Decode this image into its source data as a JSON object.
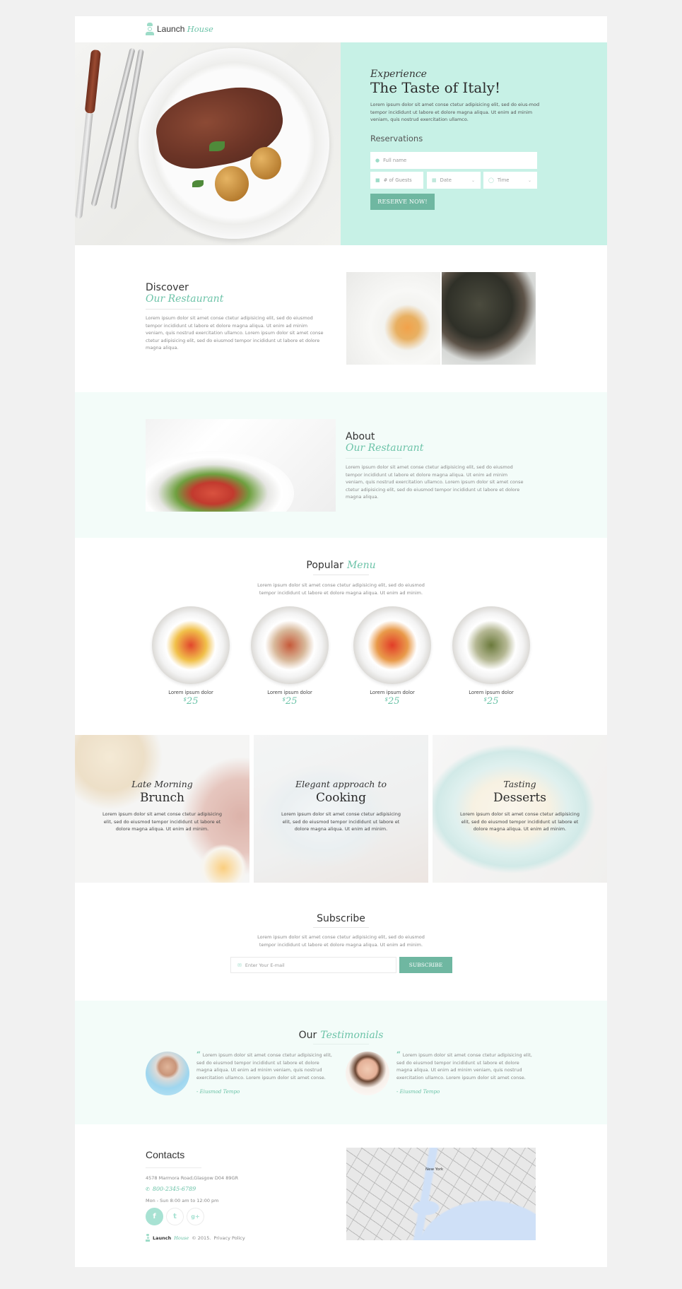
{
  "brand": {
    "name_plain": "Launch",
    "name_accent": "House"
  },
  "hero": {
    "kicker": "Experience",
    "title": "The Taste of Italy!",
    "text": "Lorem ipsum dolor sit amet conse ctetur adipisicing elit, sed do eius-mod tempor incididunt ut labore et dolore magna aliqua. Ut enim ad minim veniam, quis nostrud exercitation ullamco.",
    "reservations_title": "Reservations",
    "form": {
      "full_name_placeholder": "Full name",
      "guests_placeholder": "# of Guests",
      "date_placeholder": "Date",
      "time_placeholder": "Time",
      "submit_label": "RESERVE NOW!"
    }
  },
  "discover": {
    "title_plain": "Discover",
    "title_accent": "Our Restaurant",
    "text": "Lorem ipsum dolor sit amet conse ctetur adipisicing elit, sed do eiusmod tempor incididunt ut labore et dolore magna aliqua. Ut enim ad minim veniam, quis nostrud exercitation ullamco. Lorem ipsum dolor sit amet conse ctetur adipisicing elit, sed do eiusmod tempor incididunt ut labore et dolore magna aliqua."
  },
  "about": {
    "title_plain": "About",
    "title_accent": "Our Restaurant",
    "text": "Lorem ipsum dolor sit amet conse ctetur adipisicing elit, sed do eiusmod tempor incididunt ut labore et dolore magna aliqua. Ut enim ad minim veniam, quis nostrud exercitation ullamco. Lorem ipsum dolor sit amet conse ctetur adipisicing elit, sed do eiusmod tempor incididunt ut labore et dolore magna aliqua."
  },
  "menu": {
    "title_plain": "Popular",
    "title_accent": "Menu",
    "text": "Lorem ipsum dolor sit amet conse ctetur adipisicing elit, sed do eiusmod tempor incididunt ut labore et dolore magna aliqua. Ut enim ad minim.",
    "items": [
      {
        "name": "Lorem ipsum dolor",
        "currency": "$",
        "price": "25"
      },
      {
        "name": "Lorem ipsum dolor",
        "currency": "$",
        "price": "25"
      },
      {
        "name": "Lorem ipsum dolor",
        "currency": "$",
        "price": "25"
      },
      {
        "name": "Lorem ipsum dolor",
        "currency": "$",
        "price": "25"
      }
    ]
  },
  "features": [
    {
      "kicker": "Late Morning",
      "title": "Brunch",
      "text": "Lorem ipsum dolor sit amet conse ctetur adipisicing elit, sed do eiusmod tempor incididunt ut labore et dolore magna aliqua. Ut enim ad minim."
    },
    {
      "kicker": "Elegant approach to",
      "title": "Cooking",
      "text": "Lorem ipsum dolor sit amet conse ctetur adipisicing elit, sed do eiusmod tempor incididunt ut labore et dolore magna aliqua. Ut enim ad minim."
    },
    {
      "kicker": "Tasting",
      "title": "Desserts",
      "text": "Lorem ipsum dolor sit amet conse ctetur adipisicing elit, sed do eiusmod tempor incididunt ut labore et dolore magna aliqua. Ut enim ad minim."
    }
  ],
  "subscribe": {
    "title": "Subscribe",
    "text": "Lorem ipsum dolor sit amet conse ctetur adipisicing elit, sed do eiusmod tempor incididunt ut labore et dolore magna aliqua. Ut enim ad minim.",
    "email_placeholder": "Enter Your E-mail",
    "button_label": "SUBSCRIBE"
  },
  "testimonials": {
    "title_plain": "Our",
    "title_accent": "Testimonials",
    "items": [
      {
        "quote": "Lorem ipsum dolor sit amet conse ctetur adipisicing elit, sed do eiusmod tempor incididunt ut labore et dolore magna aliqua. Ut enim ad minim veniam, quis nostrud exercitation ullamco. Lorem ipsum dolor sit amet conse.",
        "author": "- Eiusmod Tempo"
      },
      {
        "quote": "Lorem ipsum dolor sit amet conse ctetur adipisicing elit, sed do eiusmod tempor incididunt ut labore et dolore magna aliqua. Ut enim ad minim veniam, quis nostrud exercitation ullamco. Lorem ipsum dolor sit amet conse.",
        "author": "- Eiusmod Tempo"
      }
    ]
  },
  "contacts": {
    "title": "Contacts",
    "address": "4578 Marmora Road,Glasgow D04 89GR",
    "phone": "800-2345-6789",
    "hours": "Mon - Sun 8:00 am to 12:00 pm",
    "socials": [
      {
        "name": "facebook",
        "glyph": "f"
      },
      {
        "name": "twitter",
        "glyph": "t"
      },
      {
        "name": "google-plus",
        "glyph": "g+"
      }
    ],
    "map_label": "New York"
  },
  "footer": {
    "copyright": "© 2015.",
    "privacy_label": "Privacy Policy"
  },
  "colors": {
    "accent": "#6cc3a8",
    "button": "#6fb7a1",
    "hero_panel": "#c7f1e6",
    "section_tint": "#f3fcf9"
  }
}
